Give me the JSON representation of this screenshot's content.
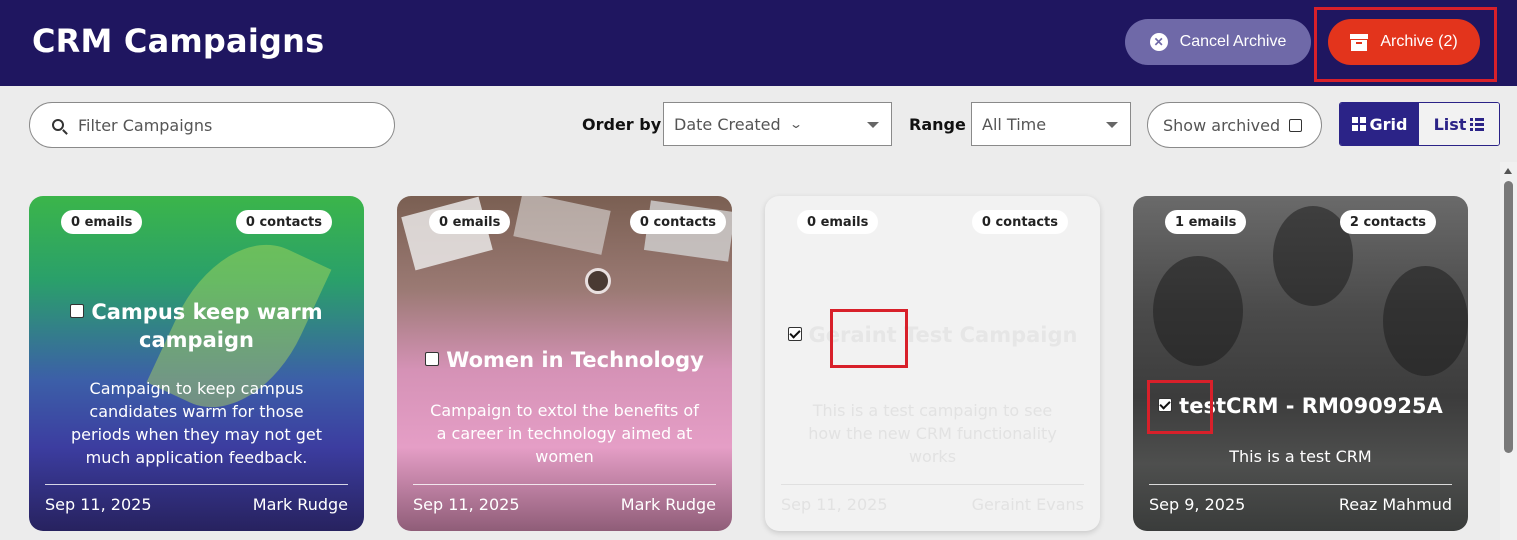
{
  "header": {
    "title": "CRM Campaigns",
    "cancel_label": "Cancel Archive",
    "archive_label": "Archive (2)"
  },
  "toolbar": {
    "filter_placeholder": "Filter Campaigns",
    "order_label": "Order by",
    "order_value": "Date Created",
    "range_label": "Range",
    "range_value": "All Time",
    "show_archived_label": "Show archived",
    "show_archived_checked": false,
    "grid_label": "Grid",
    "list_label": "List",
    "view_mode": "grid"
  },
  "campaigns": [
    {
      "emails": "0 emails",
      "contacts": "0 contacts",
      "title": "Campus keep warm campaign",
      "description": "Campaign to keep campus candidates warm for those periods when they may not get much application feedback.",
      "date": "Sep 11, 2025",
      "author": "Mark Rudge",
      "checked": false
    },
    {
      "emails": "0 emails",
      "contacts": "0 contacts",
      "title": "Women in Technology",
      "description": "Campaign to extol the benefits of a career in technology aimed at women",
      "date": "Sep 11, 2025",
      "author": "Mark Rudge",
      "checked": false
    },
    {
      "emails": "0 emails",
      "contacts": "0 contacts",
      "title": "Geraint Test Campaign",
      "description": "This is a test campaign to see how the new CRM functionality works",
      "date": "Sep 11, 2025",
      "author": "Geraint Evans",
      "checked": true
    },
    {
      "emails": "1 emails",
      "contacts": "2 contacts",
      "title": "testCRM - RM090925A",
      "description": "This is a test CRM",
      "date": "Sep 9, 2025",
      "author": "Reaz Mahmud",
      "checked": true
    }
  ],
  "colors": {
    "header_bg": "#1f1660",
    "cancel_bg": "#6f69a8",
    "archive_bg": "#e3341c",
    "accent": "#2b2387",
    "highlight": "#d8202a"
  },
  "icons": {
    "cancel": "close-circle-icon",
    "archive": "archive-box-icon",
    "filter": "search-icon",
    "grid": "grid-icon",
    "list": "list-icon"
  }
}
